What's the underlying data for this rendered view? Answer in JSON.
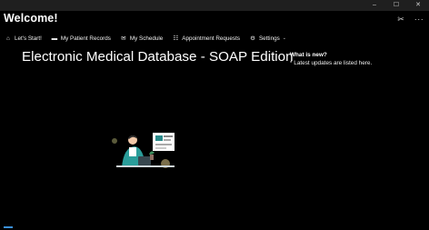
{
  "window": {
    "controls": {
      "minimize": "–",
      "maximize": "☐",
      "close": "✕"
    }
  },
  "app": {
    "title": "Welcome!"
  },
  "toolbar": {
    "icons": [
      "scissors-icon",
      "more-icon"
    ],
    "more_glyph": "···",
    "scissors_glyph": "✂"
  },
  "nav": {
    "items": [
      {
        "label": "Let's Start!",
        "icon": "home-icon",
        "glyph": "⌂"
      },
      {
        "label": "My Patient Records",
        "icon": "briefcase-icon",
        "glyph": "▬"
      },
      {
        "label": "My Schedule",
        "icon": "send-icon",
        "glyph": "✉"
      },
      {
        "label": "Appointment Requests",
        "icon": "list-icon",
        "glyph": "☷"
      },
      {
        "label": "Settings",
        "icon": "gear-icon",
        "glyph": "⚙",
        "chevron": "⌄"
      }
    ],
    "accent_color": "#3a8fd8"
  },
  "main": {
    "headline": "Electronic Medical Database - SOAP Edition"
  },
  "whats_new": {
    "title": "What is new?",
    "items": [
      "* Latest updates are listed here."
    ]
  }
}
